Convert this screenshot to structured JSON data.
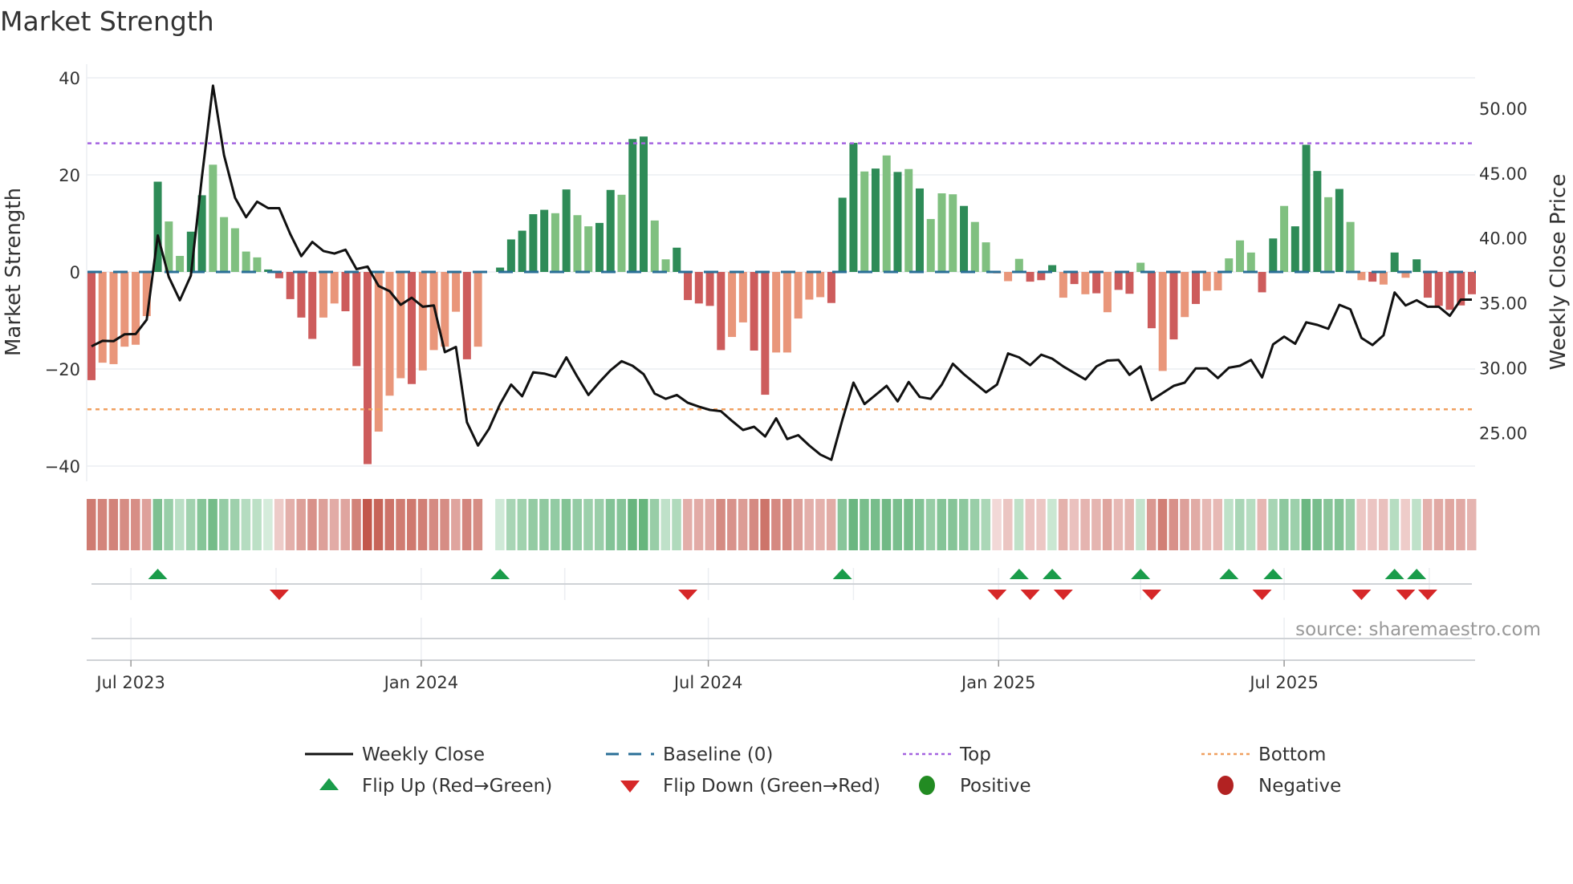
{
  "title": "Market Strength",
  "source": "source: sharemaestro.com",
  "colors": {
    "pos_strong": "#2e8b57",
    "pos_weak": "#80c080",
    "neg_strong": "#cd5c5c",
    "neg_weak": "#e9967a",
    "price": "#111111",
    "baseline": "#2a6f97",
    "top": "#a463e0",
    "bottom": "#f0a060",
    "flip_up": "#1a9c4a",
    "flip_down": "#d62728",
    "positive": "#228b22",
    "negative": "#b22222"
  },
  "chart_data": {
    "type": "bar+line",
    "title": "Market Strength",
    "ylabel": "Market Strength",
    "y2label": "Weekly Close Price",
    "ylim": [
      -44,
      44
    ],
    "y2lim": [
      22,
      52.6
    ],
    "yticks": [
      "40",
      "20",
      "0",
      "−20",
      "−40"
    ],
    "ytick_values": [
      40,
      20,
      0,
      -20,
      -40
    ],
    "y2ticks": [
      "50.00",
      "45.00",
      "40.00",
      "35.00",
      "30.00",
      "25.00"
    ],
    "y2tick_values": [
      50,
      45,
      40,
      35,
      30,
      25
    ],
    "top_level": 26.5,
    "bottom_level": -28.3,
    "start_date": "2023-06-06",
    "interval_days": 7,
    "xticks": [
      {
        "label": "Jul 2023",
        "date": "2023-07-01"
      },
      {
        "label": "Jan 2024",
        "date": "2024-01-01"
      },
      {
        "label": "Jul 2024",
        "date": "2024-07-01"
      },
      {
        "label": "Jan 2025",
        "date": "2025-01-01"
      },
      {
        "label": "Jul 2025",
        "date": "2025-07-01"
      }
    ],
    "quarter_grid": [
      "2023-07-01",
      "2023-10-01",
      "2024-01-01",
      "2024-04-01",
      "2024-07-01",
      "2024-10-01",
      "2025-01-01",
      "2025-04-01",
      "2025-07-01",
      "2025-10-01"
    ],
    "strength": [
      -22.3,
      -18.7,
      -19,
      -15.4,
      -15,
      -9.1,
      18.6,
      10.4,
      3.3,
      8.3,
      15.8,
      22.1,
      11.3,
      9,
      4.2,
      3,
      0.5,
      -1.3,
      -5.6,
      -9.4,
      -13.8,
      -9.4,
      -6.5,
      -8.1,
      -19.4,
      -39.6,
      -32.9,
      -25.5,
      -21.9,
      -23.1,
      -20.3,
      -16.1,
      -15.4,
      -8.2,
      -18,
      -15.4,
      0,
      0.9,
      6.7,
      8.5,
      11.9,
      12.8,
      12.1,
      17,
      11.7,
      9.4,
      10.1,
      16.9,
      15.9,
      27.4,
      27.9,
      10.6,
      2.6,
      5,
      -5.8,
      -6.5,
      -7,
      -16.1,
      -13.4,
      -10.4,
      -16.2,
      -25.3,
      -16.6,
      -16.6,
      -9.6,
      -5.7,
      -5.2,
      -6.4,
      15.3,
      26.6,
      20.7,
      21.3,
      24,
      20.6,
      21.2,
      17.2,
      10.9,
      16.2,
      16,
      13.6,
      10.3,
      6.1,
      -0.3,
      -1.9,
      2.7,
      -2,
      -1.7,
      1.4,
      -5.3,
      -2.5,
      -4.6,
      -4.4,
      -8.3,
      -3.7,
      -4.5,
      1.9,
      -11.6,
      -20.4,
      -13.9,
      -9.3,
      -6.6,
      -3.9,
      -3.8,
      2.8,
      6.5,
      4,
      -4.2,
      6.9,
      13.6,
      9.4,
      26.2,
      20.8,
      15.4,
      17.1,
      10.3,
      -1.7,
      -2,
      -2.6,
      4,
      -1.2,
      2.6,
      -5.3,
      -7,
      -7.8,
      -6.9,
      -4.6
    ],
    "shade": "dllllldllddllllldddddlldddllldlllldl-dddddldllddlddlldddddllddllllldddldldldllldllllldddldldlddldldldlllllddldddldlldldlddddddddll",
    "weekly_close": [
      31.65,
      32.07,
      32.05,
      32.58,
      32.6,
      33.7,
      40.2,
      37.0,
      35.2,
      37.1,
      44.7,
      51.75,
      46.4,
      43.1,
      41.6,
      42.8,
      42.3,
      42.3,
      40.3,
      38.6,
      39.7,
      39.0,
      38.8,
      39.1,
      37.6,
      37.8,
      36.3,
      35.9,
      34.85,
      35.4,
      34.7,
      34.8,
      31.2,
      31.6,
      25.8,
      24.0,
      25.3,
      27.2,
      28.7,
      27.8,
      29.65,
      29.55,
      29.3,
      30.8,
      29.3,
      27.9,
      28.9,
      29.8,
      30.5,
      30.15,
      29.5,
      28.0,
      27.6,
      27.9,
      27.3,
      27.0,
      26.75,
      26.65,
      25.9,
      25.2,
      25.45,
      24.7,
      26.1,
      24.5,
      24.8,
      24.0,
      23.3,
      22.9,
      26.0,
      28.85,
      27.2,
      27.9,
      28.6,
      27.4,
      28.9,
      27.75,
      27.6,
      28.7,
      30.3,
      29.5,
      28.8,
      28.1,
      28.7,
      31.1,
      30.8,
      30.2,
      31.0,
      30.7,
      30.1,
      29.6,
      29.1,
      30.1,
      30.55,
      30.6,
      29.45,
      30.1,
      27.5,
      28.05,
      28.6,
      28.85,
      29.95,
      29.95,
      29.2,
      30.0,
      30.15,
      30.6,
      29.25,
      31.8,
      32.4,
      31.85,
      33.5,
      33.3,
      33.0,
      34.85,
      34.5,
      32.3,
      31.75,
      32.5,
      35.8,
      34.8,
      35.2,
      34.7,
      34.7,
      34.0,
      35.25,
      35.25
    ],
    "legend": {
      "placement": "bottom",
      "items": [
        {
          "label": "Weekly Close",
          "kind": "line"
        },
        {
          "label": "Baseline (0)",
          "kind": "dash"
        },
        {
          "label": "Top",
          "kind": "dot-top"
        },
        {
          "label": "Bottom",
          "kind": "dot-bottom"
        },
        {
          "label": "Flip Up (Red→Green)",
          "kind": "tri-up"
        },
        {
          "label": "Flip Down (Green→Red)",
          "kind": "tri-down"
        },
        {
          "label": "Positive",
          "kind": "circle-pos"
        },
        {
          "label": "Negative",
          "kind": "circle-neg"
        }
      ]
    }
  }
}
